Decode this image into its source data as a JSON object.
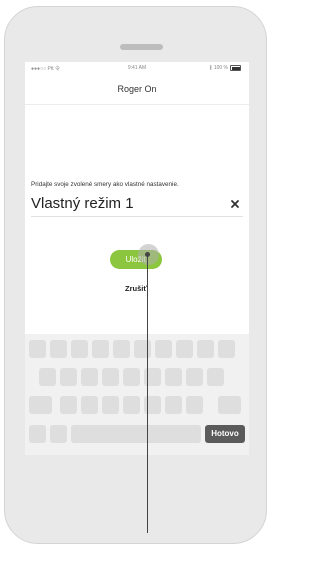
{
  "status_bar": {
    "carrier": "●●●○○ Ptt 令",
    "time": "9:41 AM",
    "battery": "100 %"
  },
  "nav": {
    "title": "Roger On"
  },
  "form": {
    "prompt": "Pridajte svoje zvolené smery ako vlastné nastavenie.",
    "name_value": "Vlastný režim 1"
  },
  "actions": {
    "save_label": "Uložiť",
    "cancel_label": "Zrušiť"
  },
  "keyboard": {
    "done_label": "Hotovo"
  },
  "colors": {
    "accent": "#8cc63f",
    "done_key": "#5b5b5b"
  }
}
